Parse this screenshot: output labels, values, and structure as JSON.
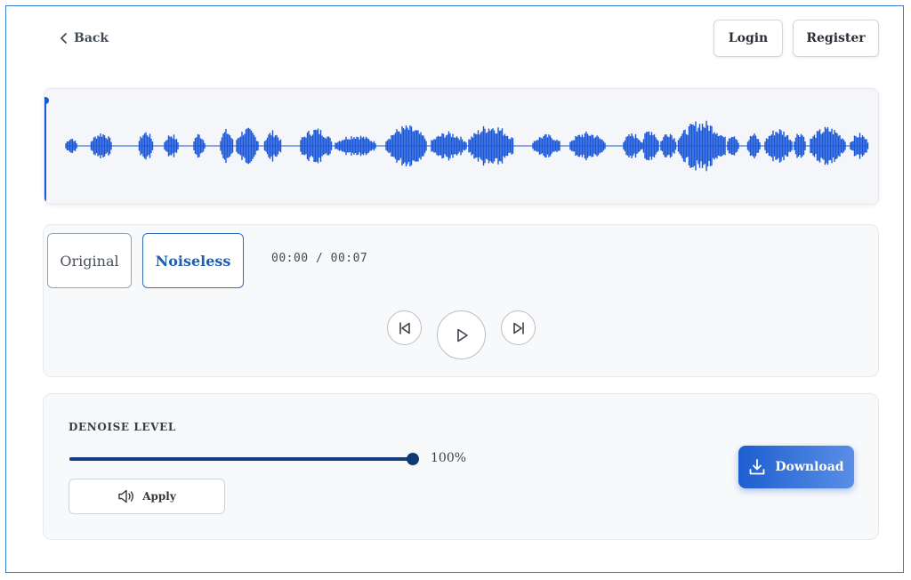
{
  "header": {
    "back_label": "Back",
    "login_label": "Login",
    "register_label": "Register"
  },
  "waveform": {
    "color": "#1a56d8",
    "playhead_color": "#1a56d8",
    "playhead_position": 0
  },
  "player": {
    "tabs": [
      {
        "label": "Original",
        "active": false
      },
      {
        "label": "Noiseless",
        "active": true
      }
    ],
    "time_display": "00:00 / 00:07",
    "controls": [
      "skip-back-icon",
      "play-icon",
      "skip-forward-icon"
    ]
  },
  "denoise": {
    "label": "DENOISE LEVEL",
    "level_percent": 100,
    "level_text": "100%",
    "apply_label": "Apply",
    "download_label": "Download",
    "accent_color": "#13407a"
  },
  "colors": {
    "brand_blue": "#1d5fcf",
    "frame_border": "#3a7bd5"
  }
}
